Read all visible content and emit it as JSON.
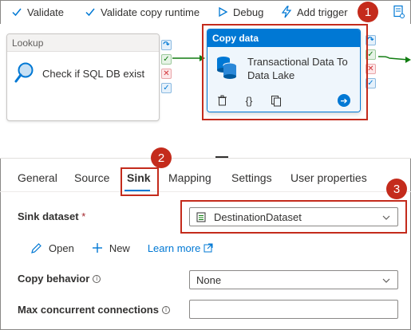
{
  "toolbar": {
    "validate": "Validate",
    "validate_copy_runtime": "Validate copy runtime",
    "debug": "Debug",
    "add_trigger": "Add trigger"
  },
  "canvas": {
    "lookup": {
      "header": "Lookup",
      "label": "Check if SQL DB exist"
    },
    "copy_data": {
      "header": "Copy data",
      "label_line1": "Transactional Data To",
      "label_line2": "Data Lake",
      "code_icon_text": "{}"
    }
  },
  "callouts": {
    "one": "1",
    "two": "2",
    "three": "3"
  },
  "tabs": {
    "general": "General",
    "source": "Source",
    "sink": "Sink",
    "mapping": "Mapping",
    "settings": "Settings",
    "user_properties": "User properties"
  },
  "sink": {
    "dataset_label": "Sink dataset",
    "required_mark": "*",
    "dataset_value": "DestinationDataset",
    "open": "Open",
    "new": "New",
    "learn_more": "Learn more",
    "copy_behavior_label": "Copy behavior",
    "copy_behavior_value": "None",
    "max_concurrent_label": "Max concurrent connections",
    "max_concurrent_value": "",
    "info_glyph": "i"
  },
  "colors": {
    "accent": "#0078d4",
    "callout": "#c42b1c",
    "success": "#107c10",
    "failure": "#d13438"
  },
  "icons": {
    "validate": "checkmark-icon",
    "validate_copy_runtime": "checkmark-icon",
    "debug": "play-icon",
    "add_trigger": "lightning-icon",
    "properties": "properties-panel-icon",
    "lookup": "magnifier-icon",
    "copy": "database-copy-icon",
    "delete": "trash-icon",
    "code": "braces-icon",
    "clone": "copy-icon",
    "go": "arrow-right-circle-icon",
    "dataset": "table-icon",
    "open": "pencil-icon",
    "new": "plus-icon",
    "external": "external-link-icon"
  }
}
